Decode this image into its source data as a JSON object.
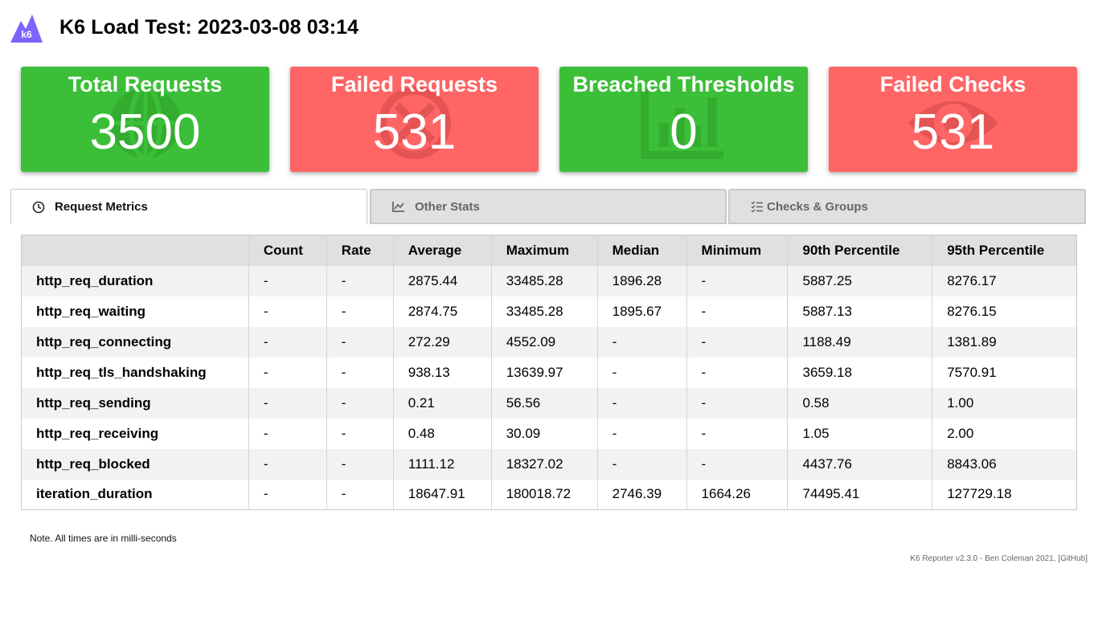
{
  "header": {
    "logo_text": "k6",
    "title": "K6 Load Test: 2023-03-08 03:14"
  },
  "cards": [
    {
      "label": "Total Requests",
      "value": "3500",
      "status": "ok",
      "icon": "globe-icon"
    },
    {
      "label": "Failed Requests",
      "value": "531",
      "status": "bad",
      "icon": "cancel-circle-icon"
    },
    {
      "label": "Breached Thresholds",
      "value": "0",
      "status": "ok",
      "icon": "bar-chart-icon"
    },
    {
      "label": "Failed Checks",
      "value": "531",
      "status": "bad",
      "icon": "eye-icon"
    }
  ],
  "colors": {
    "ok": "#3bbf38",
    "bad": "#ff6565"
  },
  "tabs": [
    {
      "label": "Request Metrics",
      "icon": "clock-icon",
      "active": true
    },
    {
      "label": "Other Stats",
      "icon": "line-chart-icon",
      "active": false
    },
    {
      "label": "Checks & Groups",
      "icon": "checklist-icon",
      "active": false
    }
  ],
  "table": {
    "columns": [
      "",
      "Count",
      "Rate",
      "Average",
      "Maximum",
      "Median",
      "Minimum",
      "90th Percentile",
      "95th Percentile"
    ],
    "rows": [
      [
        "http_req_duration",
        "-",
        "-",
        "2875.44",
        "33485.28",
        "1896.28",
        "-",
        "5887.25",
        "8276.17"
      ],
      [
        "http_req_waiting",
        "-",
        "-",
        "2874.75",
        "33485.28",
        "1895.67",
        "-",
        "5887.13",
        "8276.15"
      ],
      [
        "http_req_connecting",
        "-",
        "-",
        "272.29",
        "4552.09",
        "-",
        "-",
        "1188.49",
        "1381.89"
      ],
      [
        "http_req_tls_handshaking",
        "-",
        "-",
        "938.13",
        "13639.97",
        "-",
        "-",
        "3659.18",
        "7570.91"
      ],
      [
        "http_req_sending",
        "-",
        "-",
        "0.21",
        "56.56",
        "-",
        "-",
        "0.58",
        "1.00"
      ],
      [
        "http_req_receiving",
        "-",
        "-",
        "0.48",
        "30.09",
        "-",
        "-",
        "1.05",
        "2.00"
      ],
      [
        "http_req_blocked",
        "-",
        "-",
        "1111.12",
        "18327.02",
        "-",
        "-",
        "4437.76",
        "8843.06"
      ],
      [
        "iteration_duration",
        "-",
        "-",
        "18647.91",
        "180018.72",
        "2746.39",
        "1664.26",
        "74495.41",
        "127729.18"
      ]
    ]
  },
  "note": "Note. All times are in milli-seconds",
  "footer": "K6 Reporter v2.3.0 - Ben Coleman 2021, [GitHub]"
}
